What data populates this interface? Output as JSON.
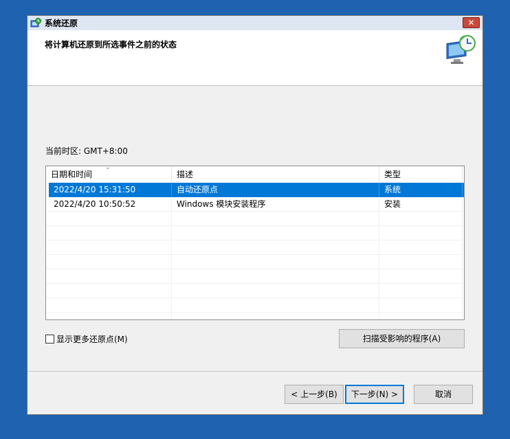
{
  "window": {
    "title": "系统还原",
    "close_label": "✕"
  },
  "header": {
    "title": "将计算机还原到所选事件之前的状态"
  },
  "timezone_label": "当前时区: GMT+8:00",
  "table": {
    "columns": [
      "日期和时间",
      "描述",
      "类型"
    ],
    "sort_indicator": "⌄",
    "rows": [
      {
        "date": "2022/4/20 15:31:50",
        "description": "自动还原点",
        "type": "系统",
        "selected": true
      },
      {
        "date": "2022/4/20 10:50:52",
        "description": "Windows 模块安装程序",
        "type": "安装",
        "selected": false
      }
    ]
  },
  "checkbox": {
    "label": "显示更多还原点(M)",
    "checked": false
  },
  "buttons": {
    "scan": "扫描受影响的程序(A)",
    "back": "< 上一步(B)",
    "next": "下一步(N) >",
    "cancel": "取消"
  },
  "colors": {
    "desktop": "#1e62b0",
    "selection": "#0078d7",
    "close": "#c8493b"
  }
}
